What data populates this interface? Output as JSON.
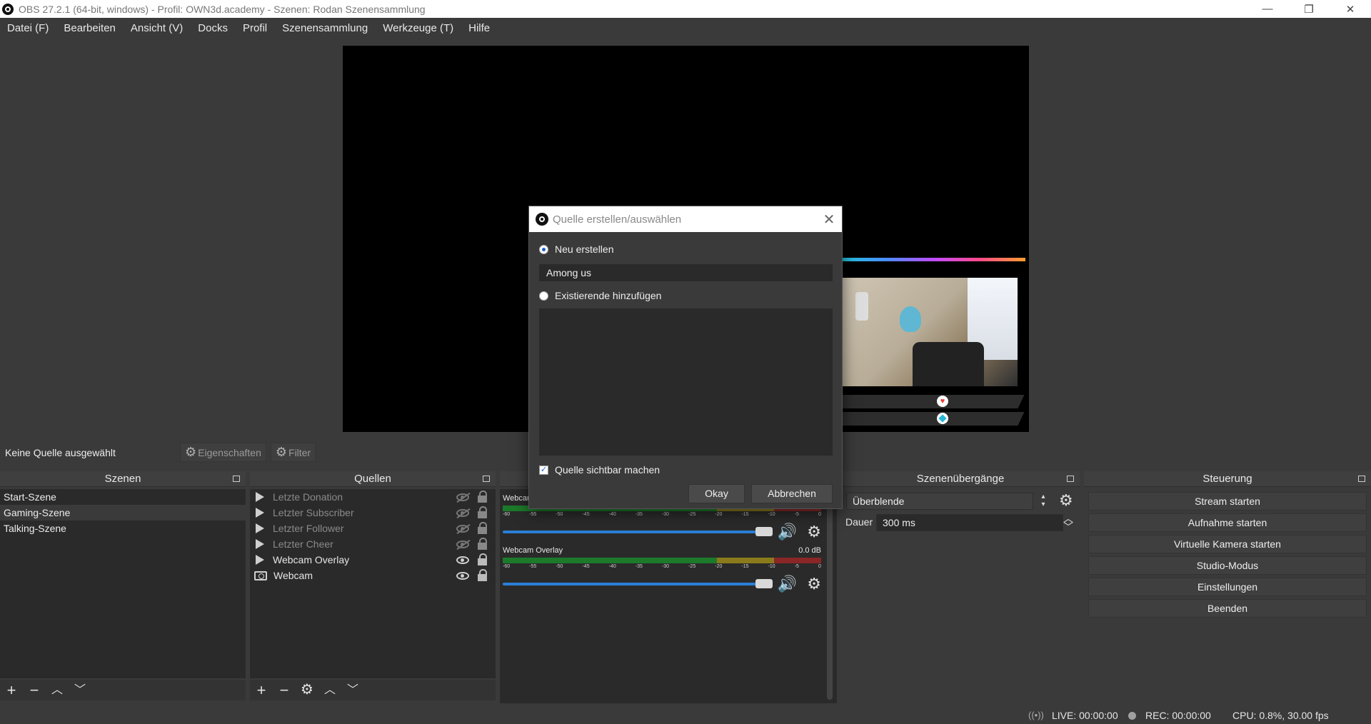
{
  "window": {
    "title": "OBS 27.2.1 (64-bit, windows) - Profil: OWN3d.academy - Szenen: Rodan Szenensammlung",
    "minimize": "—",
    "restore": "❐",
    "close": "✕"
  },
  "menu": [
    "Datei (F)",
    "Bearbeiten",
    "Ansicht (V)",
    "Docks",
    "Profil",
    "Szenensammlung",
    "Werkzeuge (T)",
    "Hilfe"
  ],
  "context": {
    "no_source": "Keine Quelle ausgewählt",
    "properties": "Eigenschaften",
    "filter": "Filter"
  },
  "scenes": {
    "title": "Szenen",
    "items": [
      "Start-Szene",
      "Gaming-Szene",
      "Talking-Szene"
    ],
    "selected": "Gaming-Szene"
  },
  "sources": {
    "title": "Quellen",
    "items": [
      {
        "name": "Letzte Donation",
        "visible": false,
        "type": "group"
      },
      {
        "name": "Letzter Subscriber",
        "visible": false,
        "type": "group"
      },
      {
        "name": "Letzter Follower",
        "visible": false,
        "type": "group"
      },
      {
        "name": "Letzter Cheer",
        "visible": false,
        "type": "group"
      },
      {
        "name": "Webcam Overlay",
        "visible": true,
        "type": "group"
      },
      {
        "name": "Webcam",
        "visible": true,
        "type": "camera"
      }
    ]
  },
  "mixer": {
    "items": [
      {
        "name": "Webcam",
        "level": ""
      },
      {
        "name": "Webcam Overlay",
        "level": "0.0 dB"
      }
    ],
    "ticks": [
      "-60",
      "-55",
      "-50",
      "-45",
      "-40",
      "-35",
      "-30",
      "-25",
      "-20",
      "-15",
      "-10",
      "-5",
      "0"
    ]
  },
  "transitions": {
    "title": "Szenenübergänge",
    "selected": "Überblende",
    "duration_label": "Dauer",
    "duration_value": "300 ms"
  },
  "controls": {
    "title": "Steuerung",
    "buttons": [
      "Stream starten",
      "Aufnahme starten",
      "Virtuelle Kamera starten",
      "Studio-Modus",
      "Einstellungen",
      "Beenden"
    ]
  },
  "status": {
    "live": "LIVE: 00:00:00",
    "rec": "REC: 00:00:00",
    "cpu": "CPU: 0.8%, 30.00 fps"
  },
  "dialog": {
    "title": "Quelle erstellen/auswählen",
    "new_label": "Neu erstellen",
    "name_value": "Among us",
    "existing_label": "Existierende hinzufügen",
    "visible_label": "Quelle sichtbar machen",
    "ok": "Okay",
    "cancel": "Abbrechen"
  },
  "colors": {
    "accent": "#2a7fd6",
    "background": "#3a3a3a",
    "panel": "#2a2a2a"
  }
}
